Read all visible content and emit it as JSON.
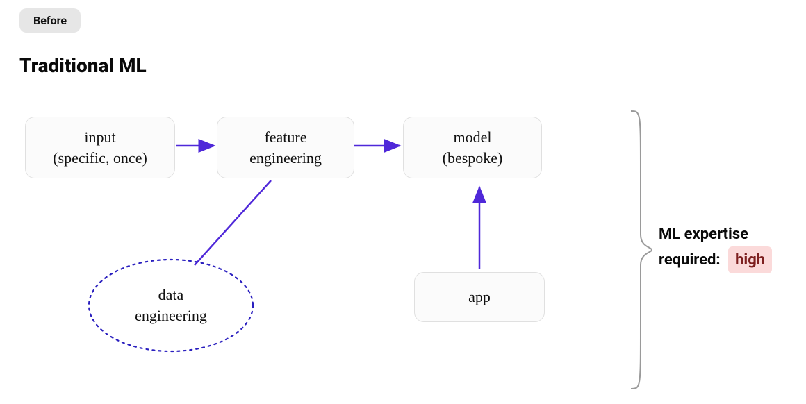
{
  "badge": "Before",
  "title": "Traditional ML",
  "nodes": {
    "input": "input\n(specific, once)",
    "feature": "feature\nengineering",
    "model": "model\n(bespoke)",
    "data_eng": "data\nengineering",
    "app": "app"
  },
  "expertise": {
    "line1": "ML expertise",
    "line2_prefix": "required:",
    "level": "high"
  },
  "colors": {
    "arrow": "#4f28d9",
    "dashed": "#2a1fbf",
    "brace": "#9a9a9a"
  }
}
